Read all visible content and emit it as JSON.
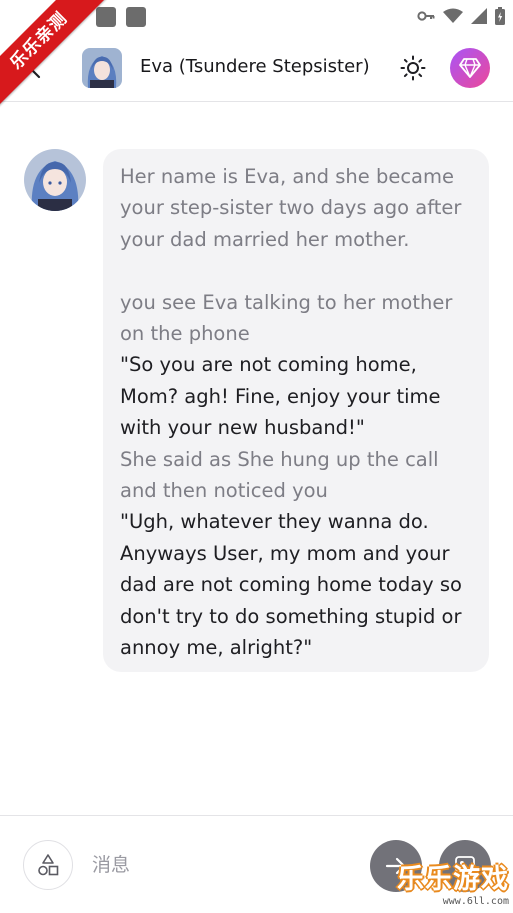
{
  "status_bar": {
    "icons": [
      "key-icon",
      "wifi-icon",
      "signal-icon",
      "battery-icon"
    ]
  },
  "ribbon": {
    "text": "乐乐亲测"
  },
  "header": {
    "title": "Eva (Tsundere Stepsister)",
    "back_icon": "chevron-left-icon",
    "theme_icon": "sun-icon",
    "premium_icon": "diamond-icon",
    "premium_gradient": [
      "#a855f7",
      "#ec4899"
    ]
  },
  "message": {
    "narration_1": "Her name is Eva, and she became your step-sister two days ago after your dad married her mother.",
    "narration_2": "you see Eva talking to her mother on the phone",
    "speech_1": "\"So you are not coming home, Mom? agh! Fine, enjoy your time with your new husband!\"",
    "narration_3": "She said as She hung up the call and then noticed you",
    "speech_2": "\"Ugh, whatever they wanna do. Anyways User, my mom and your dad are not coming home today so don't try to do something stupid or annoy me, alright?\""
  },
  "input": {
    "placeholder": "消息",
    "shapes_icon": "shapes-icon",
    "send_icon": "arrow-right-icon",
    "image_icon": "image-icon"
  },
  "watermark": {
    "main": "乐乐游戏",
    "sub": "www.6ll.com"
  },
  "colors": {
    "bubble_bg": "#f3f3f5",
    "narration_text": "#7d7d85",
    "speech_text": "#1e1e22",
    "ribbon": "#d7191c"
  }
}
